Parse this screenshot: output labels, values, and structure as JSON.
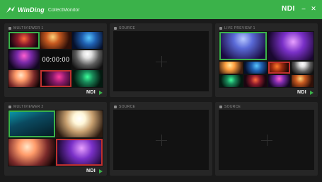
{
  "titlebar": {
    "brand": "WinDing",
    "subtitle": "CollectMonitor",
    "ndi_label": "NDI",
    "minimize_glyph": "–",
    "close_glyph": "✕",
    "accent": "#3bb24a"
  },
  "panels": [
    {
      "label": "MULTIVIEWER 1",
      "ndi": "NDI",
      "timer": "00:00:00"
    },
    {
      "label": "SOURCE",
      "ndi": ""
    },
    {
      "label": "LIVE PREVIEW 1",
      "ndi": "NDI"
    },
    {
      "label": "MULTIVIEWER 2",
      "ndi": "NDI"
    },
    {
      "label": "SOURCE",
      "ndi": ""
    },
    {
      "label": "SOURCE",
      "ndi": ""
    }
  ]
}
